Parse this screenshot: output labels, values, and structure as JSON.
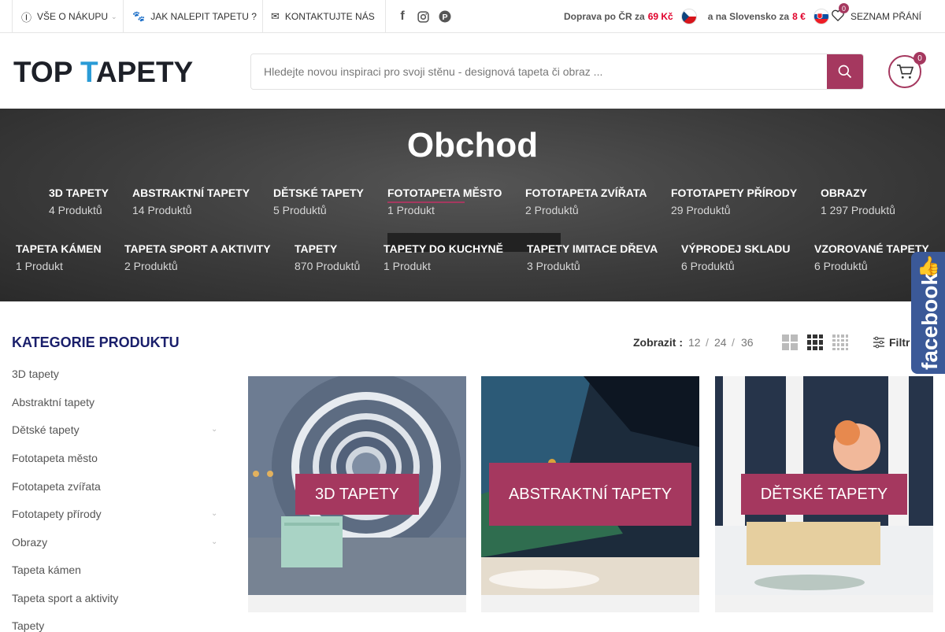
{
  "topbar": {
    "about": "VŠE O NÁKUPU",
    "howto": "JAK NALEPIT TAPETU ?",
    "contact": "KONTAKTUJTE NÁS",
    "shipping_cz_text": "Doprava po ČR za",
    "shipping_cz_price": "69 Kč",
    "shipping_sk_text": "a na Slovensko za",
    "shipping_sk_price": "8 €",
    "wishlist_label": "SEZNAM PŘÁNÍ",
    "wishlist_count": "0"
  },
  "header": {
    "logo_part1": "TOP ",
    "logo_part2": "T",
    "logo_part3": "APETY",
    "search_placeholder": "Hledejte novou inspiraci pro svoji stěnu - designová tapeta či obraz ...",
    "cart_count": "0"
  },
  "hero": {
    "title": "Obchod",
    "categories": [
      {
        "name": "3D TAPETY",
        "count": "4 Produktů"
      },
      {
        "name": "ABSTRAKTNÍ TAPETY",
        "count": "14 Produktů"
      },
      {
        "name": "DĚTSKÉ TAPETY",
        "count": "5 Produktů"
      },
      {
        "name": "FOTOTAPETA MĚSTO",
        "count": "1 Produkt"
      },
      {
        "name": "FOTOTAPETA ZVÍŘATA",
        "count": "2 Produktů"
      },
      {
        "name": "FOTOTAPETY PŘÍRODY",
        "count": "29 Produktů"
      },
      {
        "name": "OBRAZY",
        "count": "1 297 Produktů"
      },
      {
        "name": "TAPETA KÁMEN",
        "count": "1 Produkt"
      },
      {
        "name": "TAPETA SPORT A AKTIVITY",
        "count": "2 Produktů"
      },
      {
        "name": "TAPETY",
        "count": "870 Produktů"
      },
      {
        "name": "TAPETY DO KUCHYNĚ",
        "count": "1 Produkt"
      },
      {
        "name": "TAPETY IMITACE DŘEVA",
        "count": "3 Produktů"
      },
      {
        "name": "VÝPRODEJ SKLADU",
        "count": "6 Produktů"
      },
      {
        "name": "VZOROVANÉ TAPETY",
        "count": "6 Produktů"
      }
    ]
  },
  "sidebar": {
    "title": "KATEGORIE PRODUKTU",
    "items": [
      "3D tapety",
      "Abstraktní tapety",
      "Dětské tapety",
      "Fototapeta město",
      "Fototapeta zvířata",
      "Fototapety přírody",
      "Obrazy",
      "Tapeta kámen",
      "Tapeta sport a aktivity",
      "Tapety"
    ]
  },
  "toolbar": {
    "show_label": "Zobrazit :",
    "opt_12": "12",
    "opt_24": "24",
    "opt_36": "36",
    "sep": "/",
    "filter_label": "Filtr"
  },
  "facebook": {
    "label": "facebook"
  },
  "products": [
    {
      "label": "3D TAPETY"
    },
    {
      "label": "ABSTRAKTNÍ TAPETY"
    },
    {
      "label": "DĚTSKÉ TAPETY"
    }
  ],
  "colors": {
    "accent": "#a5385f",
    "title_blue": "#1a1f6b",
    "price_red": "#e0002a",
    "facebook": "#3b5998"
  }
}
